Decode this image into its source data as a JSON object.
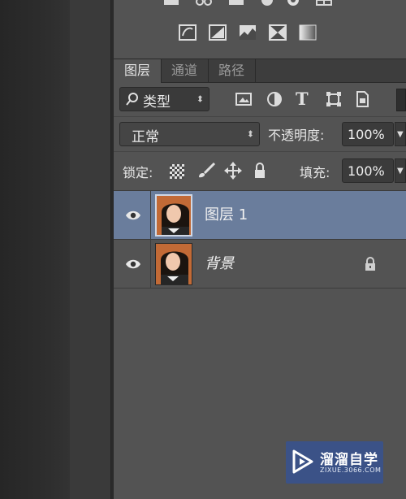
{
  "adjustment_icons_row1": [
    "brightness-contrast-icon",
    "levels-icon",
    "curves-icon",
    "exposure-icon",
    "vibrance-icon",
    "hue-saturation-icon"
  ],
  "adjustment_icons_row2": [
    "invert-icon",
    "posterize-icon",
    "threshold-icon",
    "selective-color-icon",
    "gradient-map-icon"
  ],
  "tabs": [
    {
      "label": "图层",
      "active": true
    },
    {
      "label": "通道",
      "active": false
    },
    {
      "label": "路径",
      "active": false
    }
  ],
  "filter": {
    "kind_label": "类型",
    "icons": [
      "image-filter-icon",
      "adjustment-filter-icon",
      "type-filter-icon",
      "shape-filter-icon",
      "smart-object-filter-icon"
    ]
  },
  "blend": {
    "mode": "正常",
    "opacity_label": "不透明度:",
    "opacity_value": "100%"
  },
  "lock": {
    "label": "锁定:",
    "fill_label": "填充:",
    "fill_value": "100%"
  },
  "layers": [
    {
      "name": "图层 1",
      "selected": true,
      "visible": true,
      "locked": false
    },
    {
      "name": "背景",
      "selected": false,
      "visible": true,
      "locked": true
    }
  ],
  "watermark": {
    "title": "溜溜自学",
    "subtitle": "ZIXUE.3066.COM"
  },
  "colors": {
    "panel": "#535353",
    "selected_row": "#6a7d9c",
    "watermark_bg": "#3a528c"
  }
}
